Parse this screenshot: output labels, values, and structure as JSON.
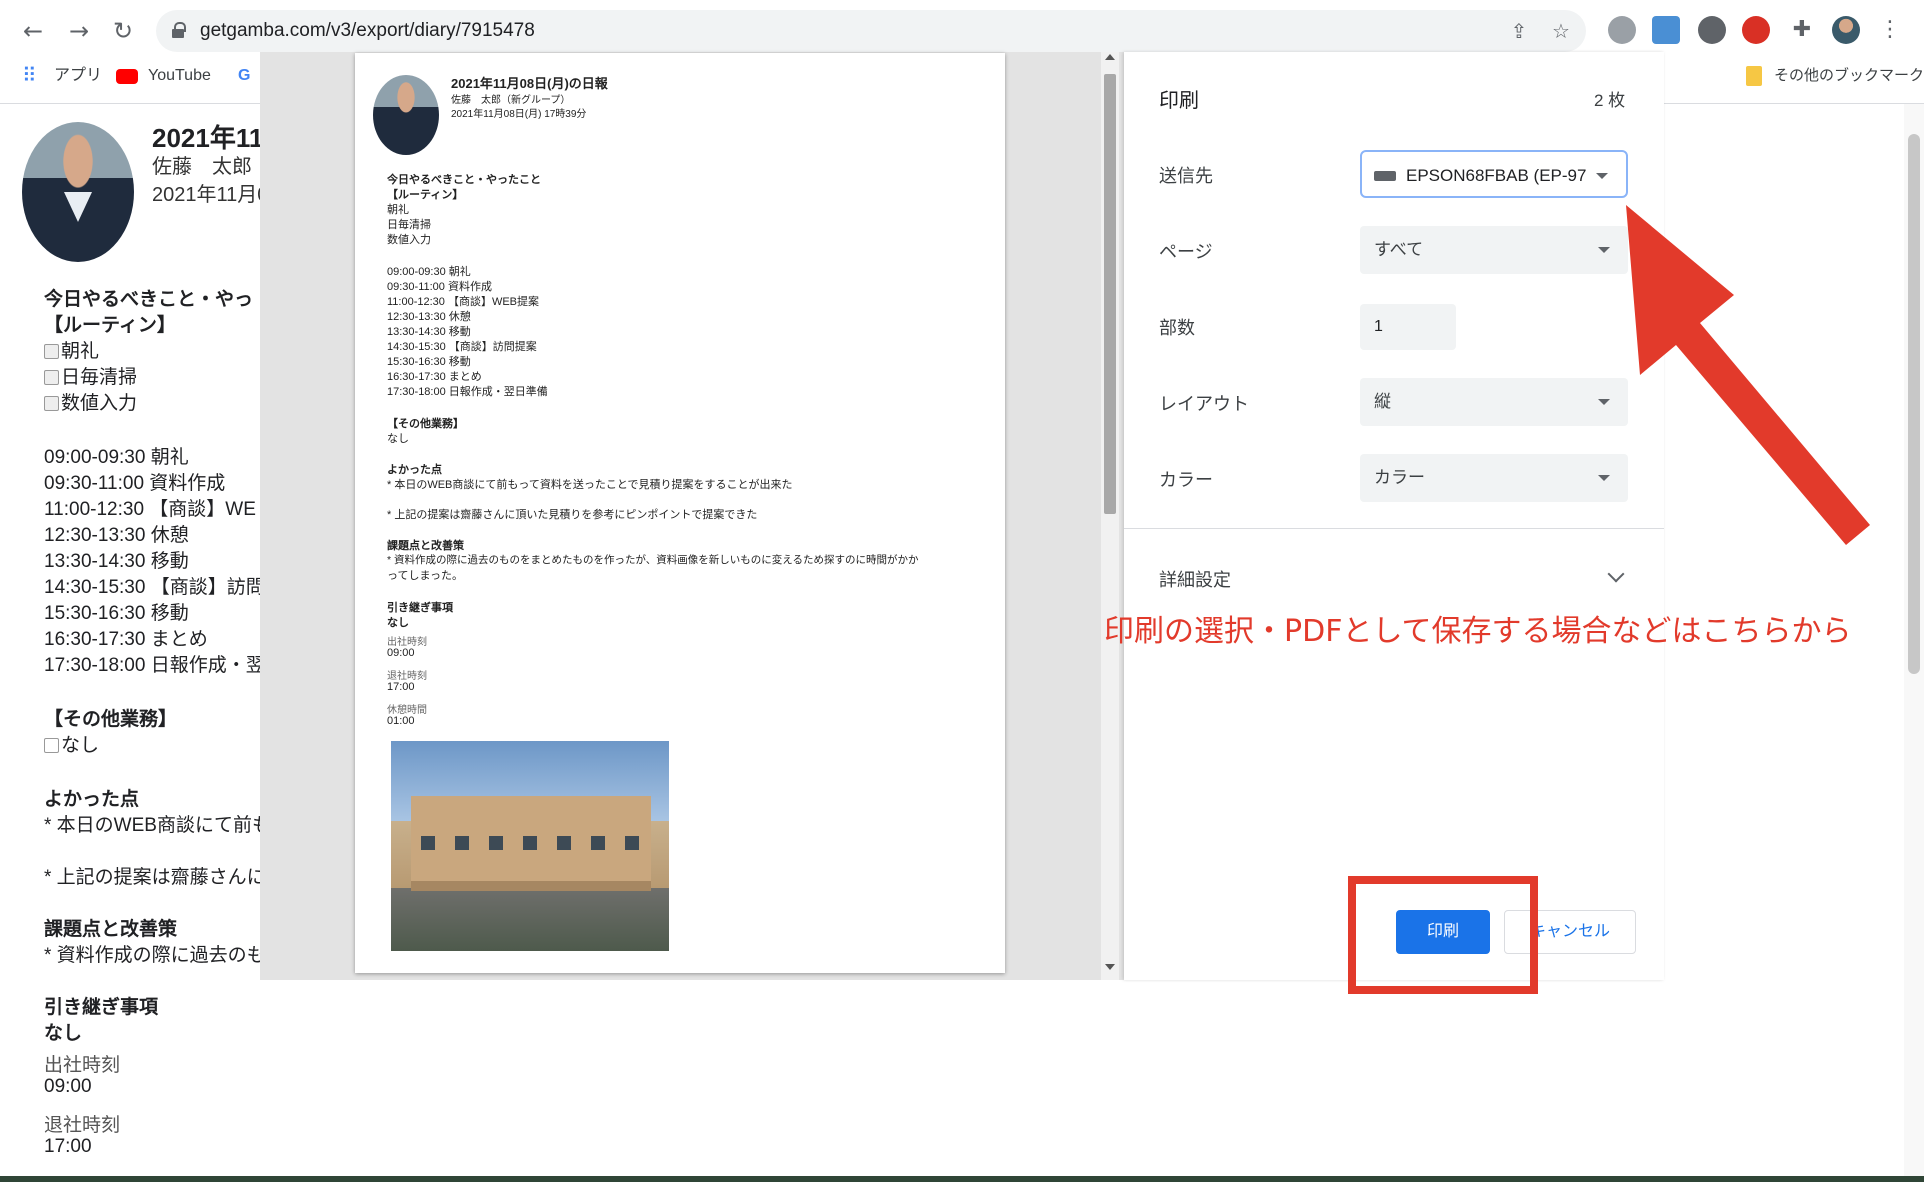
{
  "browser": {
    "url": "getgamba.com/v3/export/diary/7915478",
    "bookmarks": {
      "apps": "アプリ",
      "youtube": "YouTube",
      "other": "その他のブックマーク"
    }
  },
  "page": {
    "title": "2021年11月",
    "author": "佐藤　太郎",
    "date": "2021年11月0",
    "lines": [
      "今日やるべきこと・やっ",
      "【ルーティン】",
      "朝礼",
      "日毎清掃",
      "数値入力",
      "09:00-09:30 朝礼",
      "09:30-11:00 資料作成",
      "11:00-12:30 【商談】WE",
      "12:30-13:30 休憩",
      "13:30-14:30 移動",
      "14:30-15:30 【商談】訪問",
      "15:30-16:30 移動",
      "16:30-17:30 まとめ",
      "17:30-18:00 日報作成・翌",
      "【その他業務】",
      "なし",
      "よかった点",
      "* 本日のWEB商談にて前も",
      "* 上記の提案は齋藤さんに",
      "課題点と改善策",
      "* 資料作成の際に過去のも",
      "引き継ぎ事項",
      "なし",
      "出社時刻",
      "09:00",
      "退社時刻",
      "17:00"
    ]
  },
  "preview": {
    "title": "2021年11月08日(月)の日報",
    "author": "佐藤　太郎（新グループ）",
    "timestamp": "2021年11月08日(月) 17時39分",
    "h_todo": "今日やるべきこと・やったこと",
    "h_routine": "【ルーティン】",
    "routine": [
      "朝礼",
      "日毎清掃",
      "数値入力"
    ],
    "schedule": [
      "09:00-09:30 朝礼",
      "09:30-11:00 資料作成",
      "11:00-12:30 【商談】WEB提案",
      "12:30-13:30 休憩",
      "13:30-14:30 移動",
      "14:30-15:30 【商談】訪問提案",
      "15:30-16:30 移動",
      "16:30-17:30 まとめ",
      "17:30-18:00 日報作成・翌日準備"
    ],
    "h_other": "【その他業務】",
    "other": "なし",
    "h_good": "よかった点",
    "good1": "* 本日のWEB商談にて前もって資料を送ったことで見積り提案をすることが出来た",
    "good2": "* 上記の提案は齋藤さんに頂いた見積りを参考にピンポイントで提案できた",
    "h_issue": "課題点と改善策",
    "issue1": "* 資料作成の際に過去のものをまとめたものを作ったが、資料画像を新しいものに変えるため探すのに時間がかか",
    "issue2": "ってしまった。",
    "h_handover": "引き継ぎ事項",
    "handover": "なし",
    "in_label": "出社時刻",
    "in_value": "09:00",
    "out_label": "退社時刻",
    "out_value": "17:00",
    "break_label": "休憩時間",
    "break_value": "01:00"
  },
  "print": {
    "title": "印刷",
    "sheets": "2 枚",
    "destination_label": "送信先",
    "destination_value": "EPSON68FBAB (EP-97",
    "pages_label": "ページ",
    "pages_value": "すべて",
    "copies_label": "部数",
    "copies_value": "1",
    "layout_label": "レイアウト",
    "layout_value": "縦",
    "color_label": "カラー",
    "color_value": "カラー",
    "more_label": "詳細設定",
    "print_button": "印刷",
    "cancel_button": "キャンセル"
  },
  "annotation": {
    "text": "印刷の選択・PDFとして保存する場合などはこちらから",
    "color": "#e23a2b"
  }
}
